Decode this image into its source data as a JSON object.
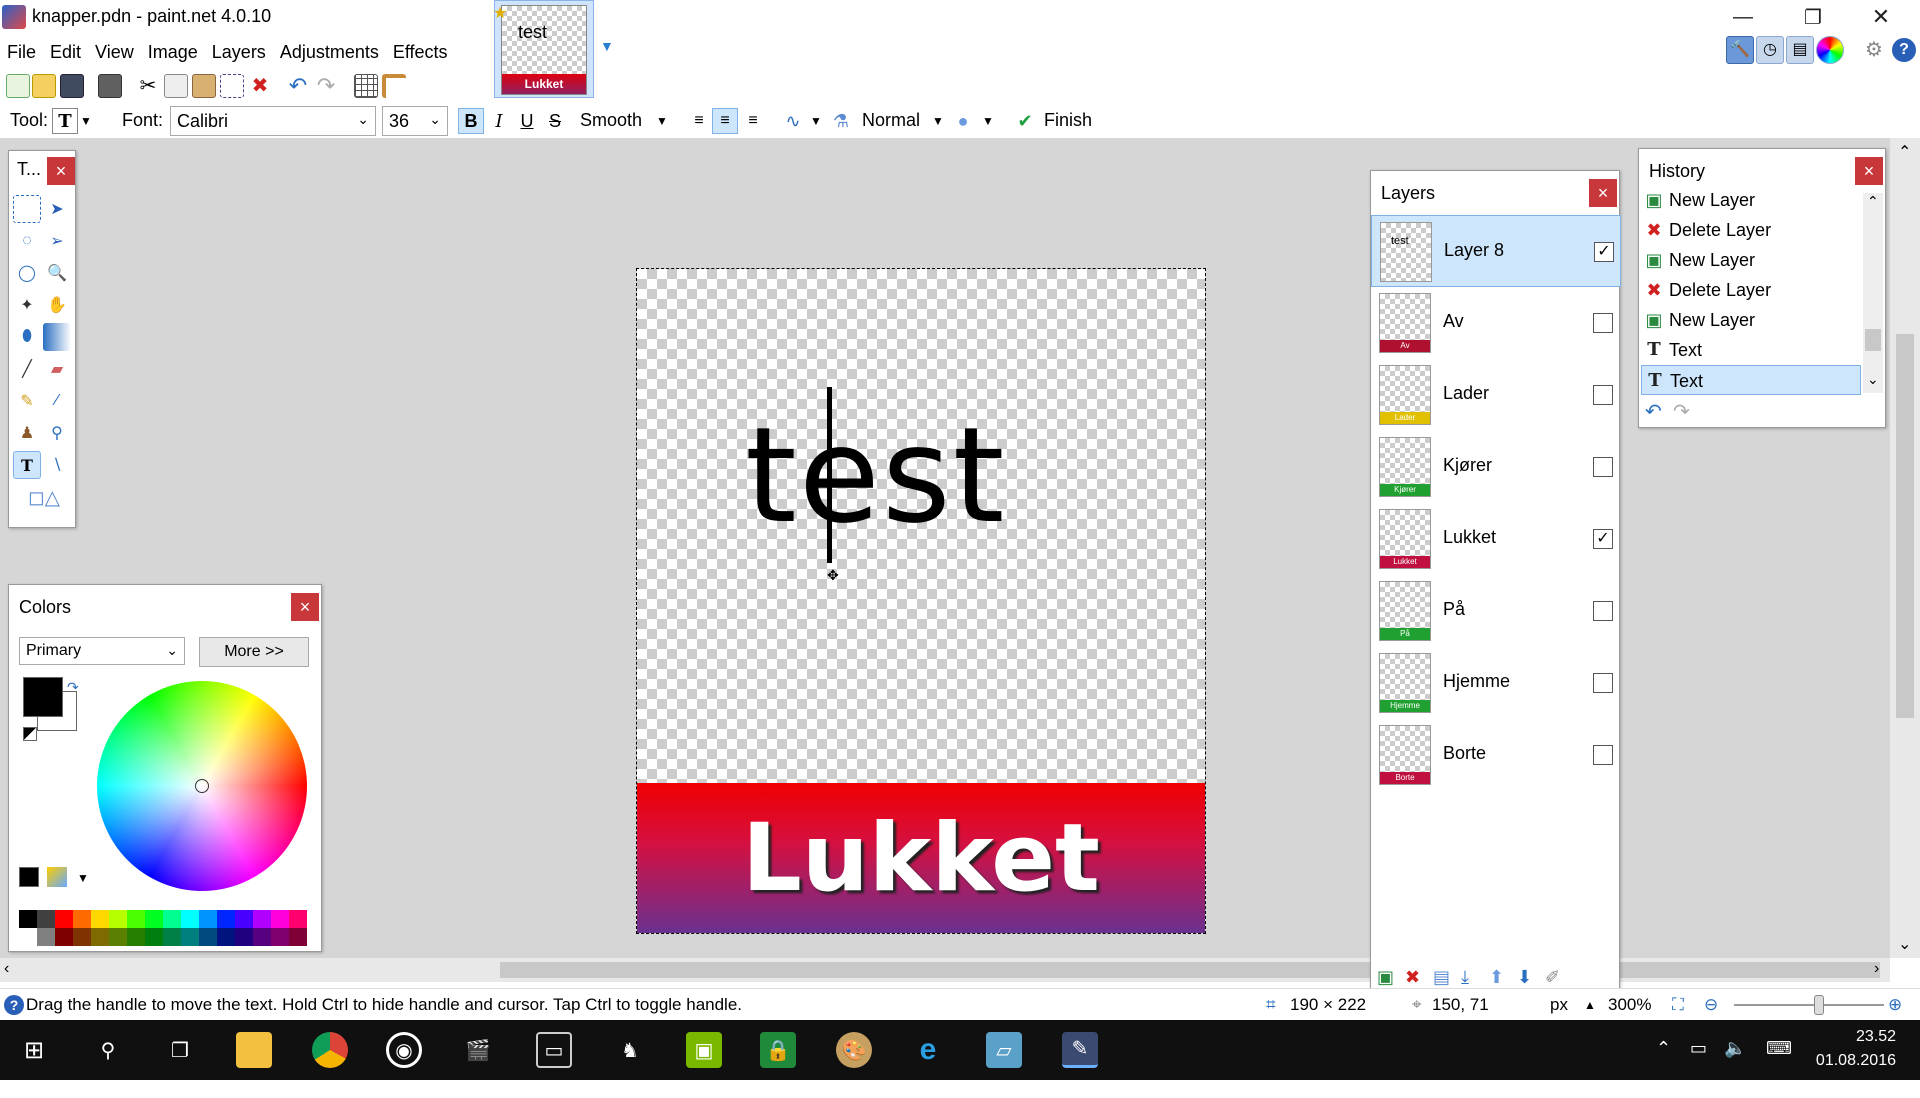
{
  "window": {
    "title": "knapper.pdn - paint.net 4.0.10",
    "minimize": "—",
    "restore": "❐",
    "close": "✕"
  },
  "thumbnail_tab": {
    "text": "test",
    "strip_label": "Lukket"
  },
  "menu": [
    "File",
    "Edit",
    "View",
    "Image",
    "Layers",
    "Adjustments",
    "Effects"
  ],
  "text_toolbar": {
    "tool_label": "Tool:",
    "font_label": "Font:",
    "font_value": "Calibri",
    "size_value": "36",
    "bold": "B",
    "italic": "I",
    "underline": "U",
    "strike": "S",
    "antialias": "Smooth",
    "blend_mode": "Normal",
    "finish": "Finish"
  },
  "tools_panel": {
    "title": "T..."
  },
  "colors_panel": {
    "title": "Colors",
    "mode": "Primary",
    "more_button": "More >>",
    "primary_color": "#000000",
    "secondary_color": "#ffffff",
    "palette_top": [
      "#000000",
      "#404040",
      "#ff0000",
      "#ff6a00",
      "#ffd800",
      "#b6ff00",
      "#4cff00",
      "#00ff21",
      "#00ff90",
      "#00ffff",
      "#0094ff",
      "#0026ff",
      "#4800ff",
      "#b200ff",
      "#ff00dc",
      "#ff006e"
    ],
    "palette_bottom": [
      "#ffffff",
      "#808080",
      "#7f0000",
      "#7f3300",
      "#7f6a00",
      "#5b7f00",
      "#267f00",
      "#007f0e",
      "#007f46",
      "#007f7f",
      "#004a7f",
      "#00137f",
      "#21007f",
      "#57007f",
      "#7f006e",
      "#7f0037"
    ]
  },
  "canvas": {
    "text": "test",
    "banner_text": "Lukket"
  },
  "layers_panel": {
    "title": "Layers",
    "layers": [
      {
        "name": "Layer 8",
        "thumb_text": "test",
        "strip_label": "",
        "strip_color": "",
        "visible": "✓",
        "selected": true
      },
      {
        "name": "Av",
        "thumb_text": "",
        "strip_label": "Av",
        "strip_color": "#b01030",
        "visible": "",
        "selected": false
      },
      {
        "name": "Lader",
        "thumb_text": "",
        "strip_label": "Lader",
        "strip_color": "#e0c000",
        "visible": "",
        "selected": false
      },
      {
        "name": "Kjører",
        "thumb_text": "",
        "strip_label": "Kjører",
        "strip_color": "#20a030",
        "visible": "",
        "selected": false
      },
      {
        "name": "Lukket",
        "thumb_text": "",
        "strip_label": "Lukket",
        "strip_color": "#c01040",
        "visible": "✓",
        "selected": false
      },
      {
        "name": "På",
        "thumb_text": "",
        "strip_label": "På",
        "strip_color": "#20a030",
        "visible": "",
        "selected": false
      },
      {
        "name": "Hjemme",
        "thumb_text": "",
        "strip_label": "Hjemme",
        "strip_color": "#20a030",
        "visible": "",
        "selected": false
      },
      {
        "name": "Borte",
        "thumb_text": "",
        "strip_label": "Borte",
        "strip_color": "#c01040",
        "visible": "",
        "selected": false
      }
    ]
  },
  "history_panel": {
    "title": "History",
    "items": [
      {
        "label": "New Layer",
        "icon": "new-layer-icon"
      },
      {
        "label": "Delete Layer",
        "icon": "delete-layer-icon"
      },
      {
        "label": "New Layer",
        "icon": "new-layer-icon"
      },
      {
        "label": "Delete Layer",
        "icon": "delete-layer-icon"
      },
      {
        "label": "New Layer",
        "icon": "new-layer-icon"
      },
      {
        "label": "Text",
        "icon": "text-icon"
      },
      {
        "label": "Text",
        "icon": "text-icon"
      }
    ]
  },
  "status": {
    "hint": "Drag the handle to move the text. Hold Ctrl to hide handle and cursor. Tap Ctrl to toggle handle.",
    "size": "190 × 222",
    "cursor": "150, 71",
    "units": "px",
    "zoom": "300%"
  },
  "taskbar": {
    "time": "23.52",
    "date": "01.08.2016"
  }
}
